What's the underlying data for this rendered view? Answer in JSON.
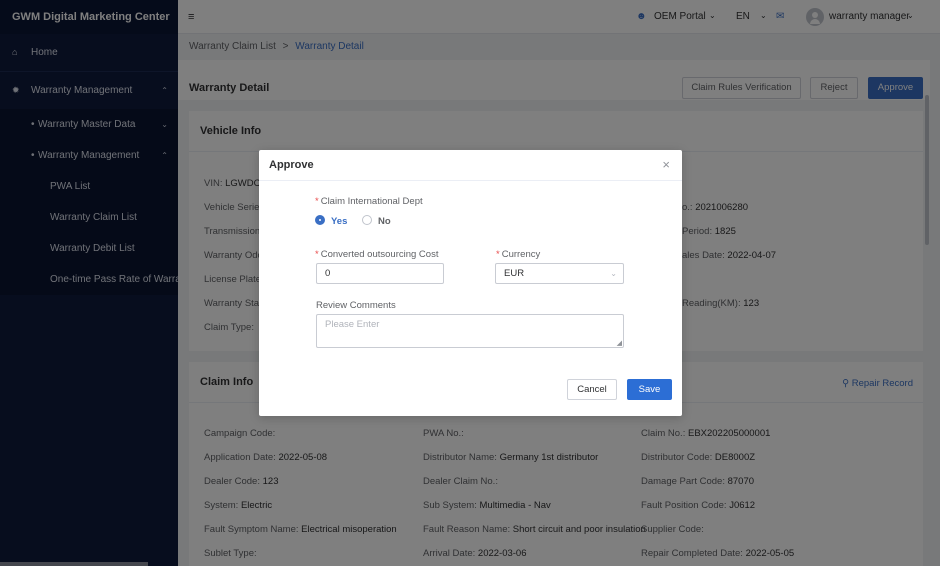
{
  "app": {
    "brand": "GWM Digital Marketing Center"
  },
  "sidebar": {
    "home": "Home",
    "warranty_management": "Warranty Management",
    "master_data": "Warranty Master Data",
    "warranty_mgmt_sub": "Warranty Management",
    "items": [
      "PWA List",
      "Warranty Claim List",
      "Warranty Debit List",
      "One-time Pass Rate of Warranty"
    ]
  },
  "header": {
    "portal": "OEM Portal",
    "language": "EN",
    "user": "warranty manager"
  },
  "breadcrumb": {
    "parent": "Warranty Claim List",
    "separator": ">",
    "current": "Warranty Detail"
  },
  "page": {
    "title": "Warranty Detail",
    "buttons": {
      "rules": "Claim Rules Verification",
      "reject": "Reject",
      "approve": "Approve"
    }
  },
  "vehicle_info": {
    "title": "Vehicle Info",
    "fields": [
      {
        "label": "VIN:",
        "value": "LGWDC"
      },
      {
        "label": "Vehicle Serie",
        "value": ""
      },
      {
        "label": "Transmission",
        "value": ""
      },
      {
        "label": "Warranty Odo",
        "value": ""
      },
      {
        "label": "License Plate",
        "value": ""
      },
      {
        "label": "Warranty Sta",
        "value": ""
      },
      {
        "label": "Claim Type:",
        "value": ""
      }
    ],
    "right_fields": [
      {
        "label": "o.:",
        "value": "2021006280"
      },
      {
        "label": "Period:",
        "value": "1825"
      },
      {
        "label": "ales Date:",
        "value": "2022-04-07"
      },
      {
        "label": "Reading(KM):",
        "value": "123"
      }
    ]
  },
  "claim_info": {
    "title": "Claim Info",
    "repair_record": "Repair Record",
    "rows": [
      [
        {
          "label": "Campaign Code:",
          "value": ""
        },
        {
          "label": "PWA No.:",
          "value": ""
        },
        {
          "label": "Claim No.:",
          "value": "EBX202205000001"
        }
      ],
      [
        {
          "label": "Application Date:",
          "value": "2022-05-08"
        },
        {
          "label": "Distributor Name:",
          "value": "Germany 1st distributor"
        },
        {
          "label": "Distributor Code:",
          "value": "DE8000Z"
        }
      ],
      [
        {
          "label": "Dealer Code:",
          "value": "123"
        },
        {
          "label": "Dealer Claim No.:",
          "value": ""
        },
        {
          "label": "Damage Part Code:",
          "value": "87070"
        }
      ],
      [
        {
          "label": "System:",
          "value": "Electric"
        },
        {
          "label": "Sub System:",
          "value": "Multimedia - Nav"
        },
        {
          "label": "Fault Position Code:",
          "value": "J0612"
        }
      ],
      [
        {
          "label": "Fault Symptom Name:",
          "value": "Electrical misoperation"
        },
        {
          "label": "Fault Reason Name:",
          "value": "Short circuit and poor insulation"
        },
        {
          "label": "Supplier Code:",
          "value": ""
        }
      ],
      [
        {
          "label": "Sublet Type:",
          "value": ""
        },
        {
          "label": "Arrival Date:",
          "value": "2022-03-06"
        },
        {
          "label": "Repair Completed Date:",
          "value": "2022-05-05"
        }
      ]
    ]
  },
  "dialog": {
    "title": "Approve",
    "close_glyph": "×",
    "dept_label": "Claim International Dept",
    "yes": "Yes",
    "no": "No",
    "cost_label": "Converted outsourcing Cost",
    "cost_value": "0",
    "currency_label": "Currency",
    "currency_value": "EUR",
    "comments_label": "Review Comments",
    "comments_placeholder": "Please Enter",
    "cancel": "Cancel",
    "save": "Save",
    "required_mark": "*"
  },
  "colors": {
    "accent": "#3a6fc4",
    "sidebar_bg": "#0e1a3d",
    "required": "#e84c4c"
  }
}
